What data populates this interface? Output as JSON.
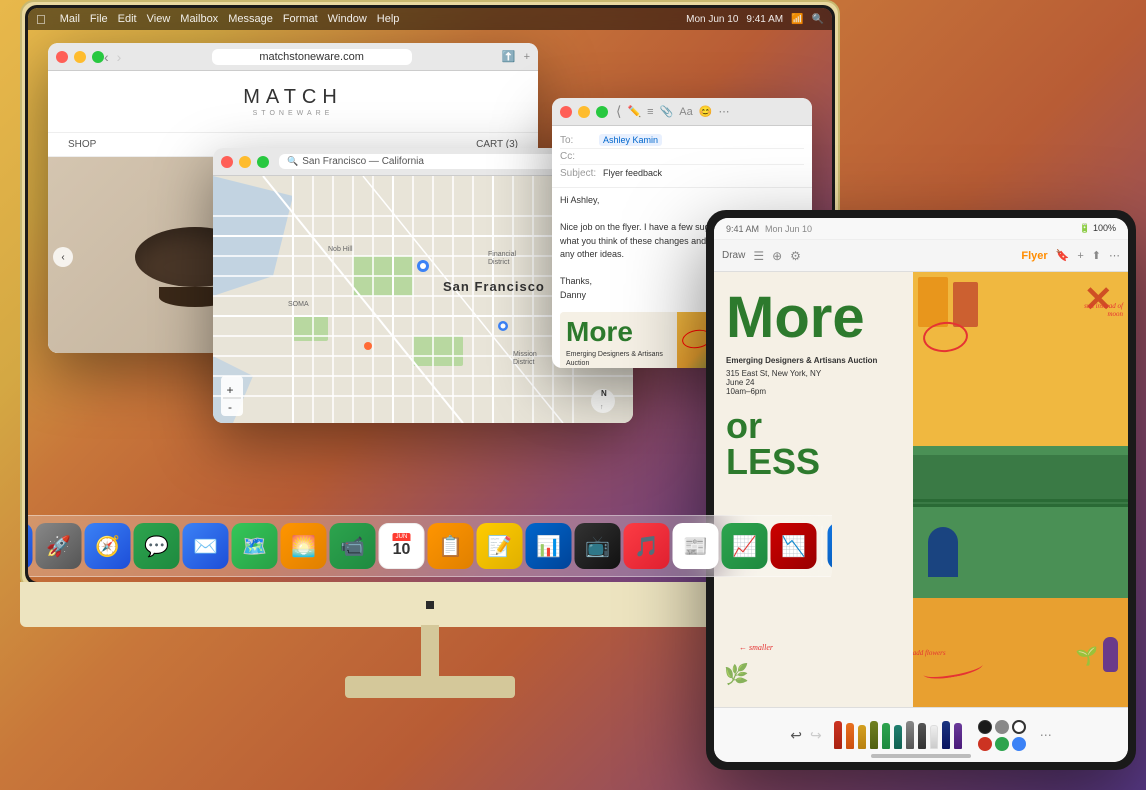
{
  "desktop": {
    "background": "gradient warm"
  },
  "menubar": {
    "apple": "⌘",
    "items": [
      "Mail",
      "File",
      "Edit",
      "View",
      "Mailbox",
      "Message",
      "Format",
      "Window",
      "Help"
    ],
    "right": [
      "Mon Jun 10",
      "9:41 AM"
    ]
  },
  "safari": {
    "url": "matchstoneware.com",
    "logo": "MATCH",
    "sublogo": "STONEWARE",
    "nav": "SHOP",
    "cart": "CART (3)"
  },
  "maps": {
    "search": "San Francisco — California",
    "location_label": "San Francisco",
    "mode": "3D"
  },
  "mail": {
    "to_label": "To:",
    "to_value": "Ashley Kamin",
    "cc_label": "Cc:",
    "subject_label": "Subject:",
    "subject_value": "Flyer feedback",
    "body": "Hi Ashley,\n\nNice job on the flyer. I have a few suggestions for you. See what you think of these changes and let me know if you have any other ideas.\n\nThanks,\nDanny"
  },
  "flyer": {
    "more_text": "More",
    "or_text": "or",
    "less_text": "LESS",
    "event_name": "Emerging Designers & Artisans Auction",
    "address": "315 East St, New York, NY",
    "date": "June 24",
    "time": "10am–6pm",
    "annotation_smaller": "smaller",
    "annotation_sun": "sun instead of moon",
    "annotation_add_flowers": "add flowers"
  },
  "ipad": {
    "status_left": [
      "Draw",
      "≡",
      "⊕",
      "☰"
    ],
    "title": "Flyer",
    "status_right": [
      "100%",
      "🔋"
    ],
    "toolbar_items": [
      "Draw",
      "≡",
      "⊕",
      "☰"
    ],
    "home_indicator": true
  },
  "dock": {
    "icons": [
      {
        "name": "finder",
        "emoji": "🐟",
        "color": "#1175e0"
      },
      {
        "name": "launchpad",
        "emoji": "🚀",
        "color": "#666"
      },
      {
        "name": "safari",
        "emoji": "🧭",
        "color": "#1175e0"
      },
      {
        "name": "messages",
        "emoji": "💬",
        "color": "#2da44e"
      },
      {
        "name": "mail",
        "emoji": "✉️",
        "color": "#3b82f6"
      },
      {
        "name": "maps",
        "emoji": "🗺️",
        "color": "#34c759"
      },
      {
        "name": "photos",
        "emoji": "🌅",
        "color": "#ff9500"
      },
      {
        "name": "facetime",
        "emoji": "📹",
        "color": "#2da44e"
      },
      {
        "name": "calendar",
        "emoji": "📅",
        "color": "#ff3b30"
      },
      {
        "name": "reminders",
        "emoji": "📋",
        "color": "#ff9500"
      },
      {
        "name": "notes",
        "emoji": "📝",
        "color": "#ffcc00"
      },
      {
        "name": "keynote",
        "emoji": "📊",
        "color": "#0066cc"
      },
      {
        "name": "appletv",
        "emoji": "📺",
        "color": "#1a1a1a"
      },
      {
        "name": "music",
        "emoji": "🎵",
        "color": "#fc3c44"
      },
      {
        "name": "news",
        "emoji": "📰",
        "color": "#ff3b30"
      },
      {
        "name": "numbers",
        "emoji": "📈",
        "color": "#2da44e"
      },
      {
        "name": "grapher",
        "emoji": "📉",
        "color": "#cc0000"
      },
      {
        "name": "appstore",
        "emoji": "🛍️",
        "color": "#1175e0"
      }
    ]
  },
  "colors": {
    "accent_green": "#2d7a2d",
    "accent_orange": "#e8a030",
    "annotation_red": "#e53333",
    "blue_door": "#1a4480",
    "arch_red": "#cc4422"
  }
}
